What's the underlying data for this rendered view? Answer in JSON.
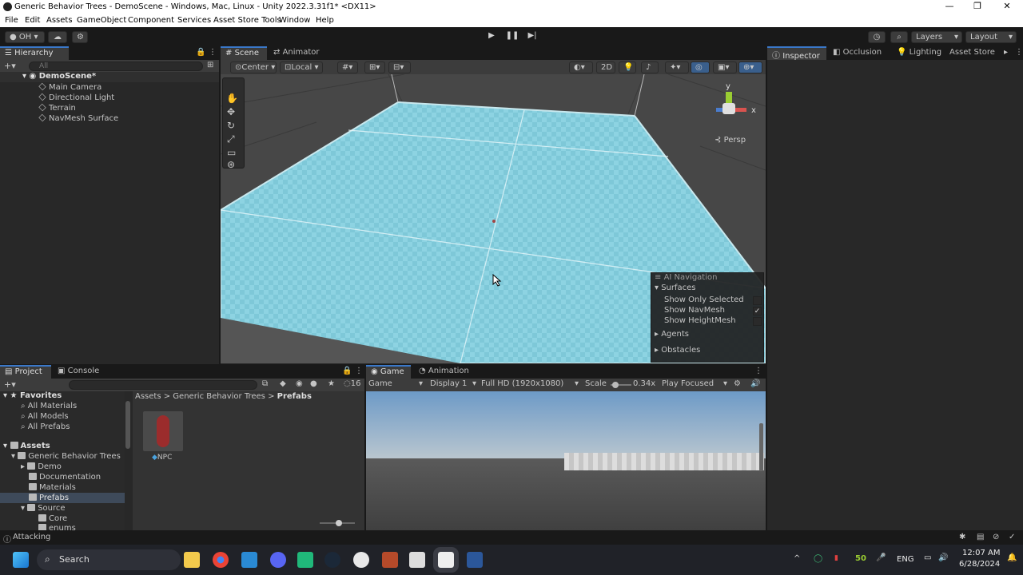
{
  "window": {
    "title": "Generic Behavior Trees - DemoScene - Windows, Mac, Linux - Unity 2022.3.31f1* <DX11>"
  },
  "menu": [
    "File",
    "Edit",
    "Assets",
    "GameObject",
    "Component",
    "Services",
    "Asset Store Tools",
    "Window",
    "Help"
  ],
  "toolbar": {
    "account": "OH",
    "layers": "Layers",
    "layout": "Layout"
  },
  "hierarchy": {
    "tab": "Hierarchy",
    "search_placeholder": "All",
    "scene": "DemoScene*",
    "items": [
      "Main Camera",
      "Directional Light",
      "Terrain",
      "NavMesh Surface"
    ]
  },
  "scene": {
    "tabs": [
      "Scene",
      "Animator"
    ],
    "pivot": "Center",
    "space": "Local",
    "mode_2d": "2D",
    "persp": "Persp",
    "gizmo_y": "y",
    "gizmo_x": "x"
  },
  "ai_navigation": {
    "title": "AI Navigation",
    "surfaces": "Surfaces",
    "options": [
      {
        "label": "Show Only Selected",
        "checked": false
      },
      {
        "label": "Show NavMesh",
        "checked": true
      },
      {
        "label": "Show HeightMesh",
        "checked": false
      }
    ],
    "agents": "Agents",
    "obstacles": "Obstacles"
  },
  "inspector": {
    "tabs": [
      "Inspector",
      "Occlusion",
      "Lighting",
      "Asset Store"
    ]
  },
  "project": {
    "tabs": [
      "Project",
      "Console"
    ],
    "count": "16",
    "favorites": "Favorites",
    "favorite_items": [
      "All Materials",
      "All Models",
      "All Prefabs"
    ],
    "assets": "Assets",
    "tree": [
      "Generic Behavior Trees",
      "Demo",
      "Documentation",
      "Materials",
      "Prefabs",
      "Source",
      "Core",
      "enums"
    ],
    "breadcrumb": [
      "Assets",
      "Generic Behavior Trees",
      "Prefabs"
    ],
    "asset_name": "NPC"
  },
  "game": {
    "tabs": [
      "Game",
      "Animation"
    ],
    "mode": "Game",
    "display": "Display 1",
    "resolution": "Full HD (1920x1080)",
    "scale_label": "Scale",
    "scale_value": "0.34x",
    "play_mode": "Play Focused"
  },
  "status": {
    "text": "Attacking"
  },
  "taskbar": {
    "search": "Search",
    "language": "ENG",
    "time": "12:07 AM",
    "date": "6/28/2024",
    "tray_num1": "50"
  }
}
